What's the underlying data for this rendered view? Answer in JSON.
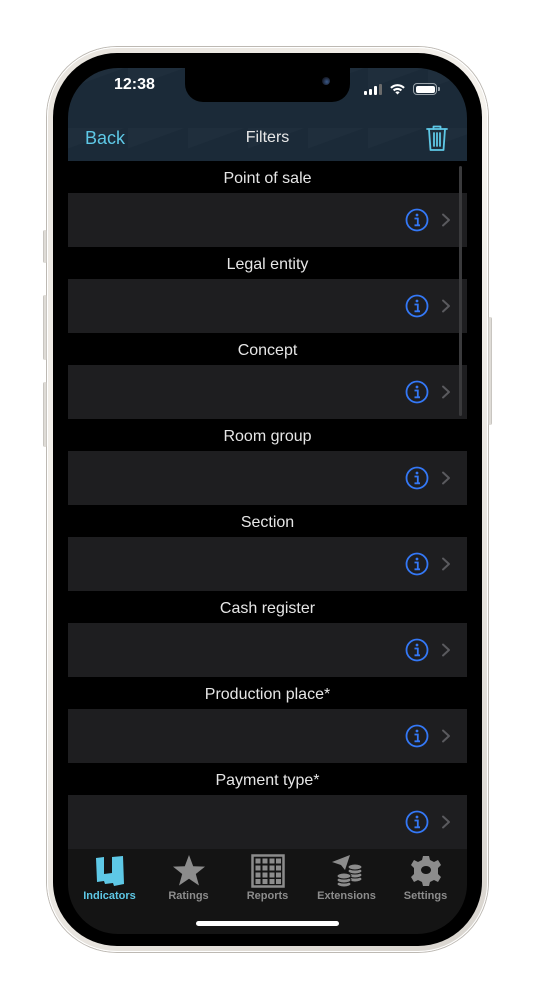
{
  "status_bar": {
    "time": "12:38",
    "signal_icon": "cellular-signal-icon",
    "wifi_icon": "wifi-icon",
    "battery_icon": "battery-icon"
  },
  "nav": {
    "back_label": "Back",
    "title": "Filters",
    "trash_icon": "trash-icon"
  },
  "colors": {
    "accent": "#5ec8e6",
    "info_blue": "#3478f6",
    "header_bg": "#1b2a38",
    "row_bg": "#1e1e20",
    "tab_inactive": "#8c8c8c"
  },
  "filters": [
    {
      "label": "Point of sale",
      "value": ""
    },
    {
      "label": "Legal entity",
      "value": ""
    },
    {
      "label": "Concept",
      "value": ""
    },
    {
      "label": "Room group",
      "value": ""
    },
    {
      "label": "Section",
      "value": ""
    },
    {
      "label": "Cash register",
      "value": ""
    },
    {
      "label": "Production place*",
      "value": ""
    },
    {
      "label": "Payment type*",
      "value": ""
    }
  ],
  "tabbar": {
    "items": [
      {
        "label": "Indicators",
        "icon": "indicators-icon",
        "active": true
      },
      {
        "label": "Ratings",
        "icon": "star-icon",
        "active": false
      },
      {
        "label": "Reports",
        "icon": "grid-icon",
        "active": false
      },
      {
        "label": "Extensions",
        "icon": "extensions-icon",
        "active": false
      },
      {
        "label": "Settings",
        "icon": "gear-icon",
        "active": false
      }
    ]
  }
}
